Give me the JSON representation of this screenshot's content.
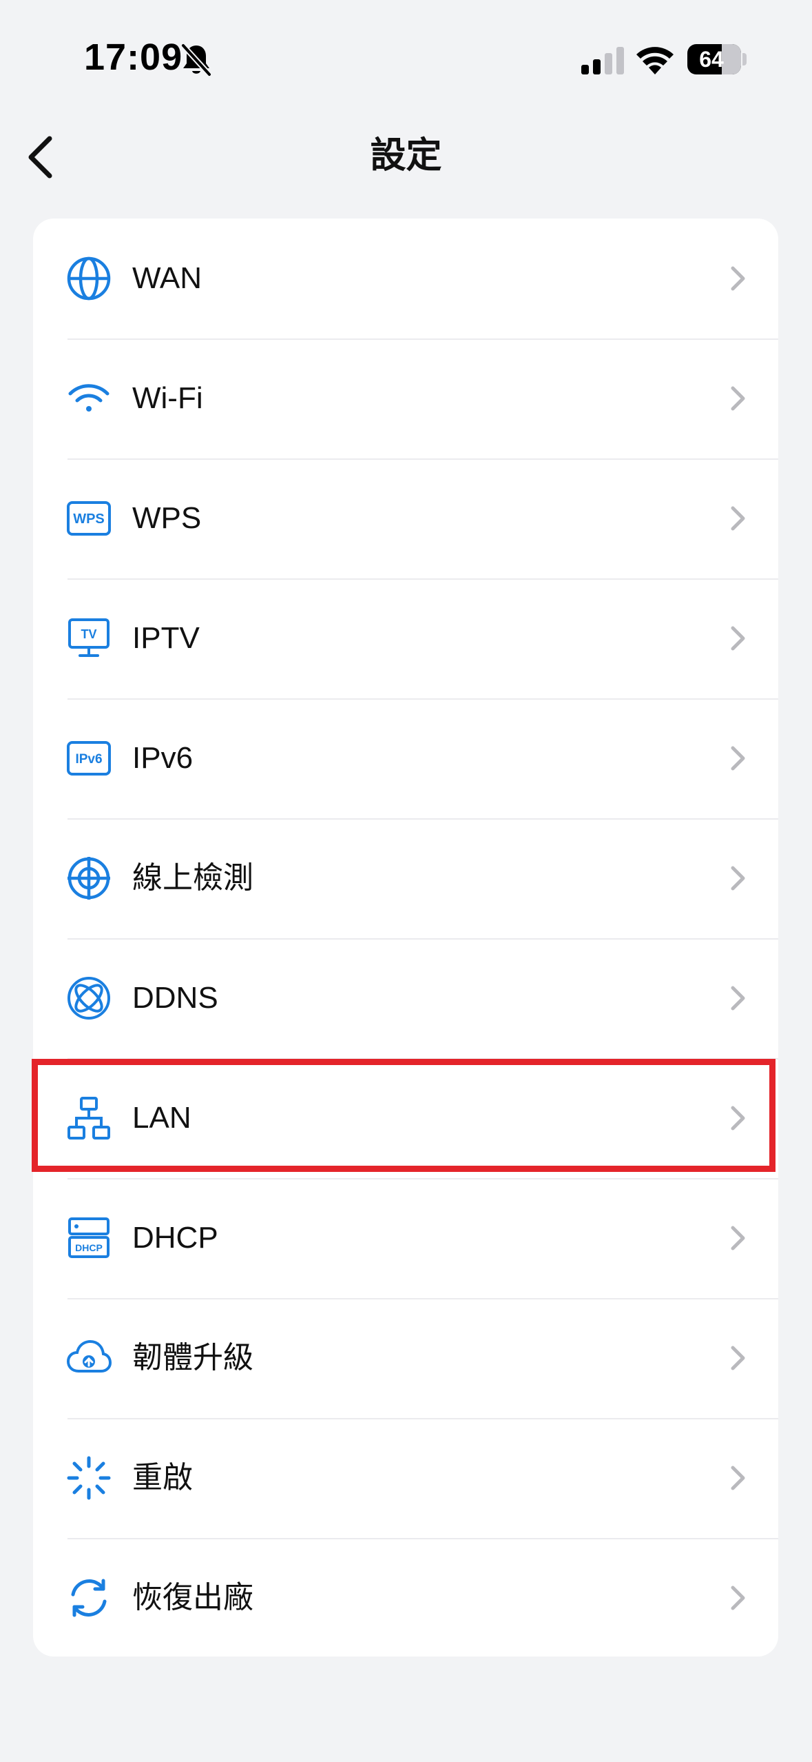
{
  "status_bar": {
    "time": "17:09",
    "battery_level": "64",
    "icons": [
      "mute-icon",
      "signal-icon",
      "wifi-icon",
      "battery-icon"
    ]
  },
  "nav": {
    "title": "設定",
    "back_icon": "chevron-left-icon"
  },
  "colors": {
    "accent": "#1a7fe0",
    "highlight": "#e4242a",
    "background": "#f2f3f5"
  },
  "settings": {
    "items": [
      {
        "label": "WAN",
        "icon": "globe-icon"
      },
      {
        "label": "Wi-Fi",
        "icon": "wifi-icon"
      },
      {
        "label": "WPS",
        "icon": "wps-icon"
      },
      {
        "label": "IPTV",
        "icon": "tv-icon"
      },
      {
        "label": "IPv6",
        "icon": "ipv6-icon"
      },
      {
        "label": "線上檢測",
        "icon": "crosshair-icon"
      },
      {
        "label": "DDNS",
        "icon": "orbit-globe-icon"
      },
      {
        "label": "LAN",
        "icon": "network-icon",
        "highlighted": true
      },
      {
        "label": "DHCP",
        "icon": "dhcp-icon"
      },
      {
        "label": "韌體升級",
        "icon": "cloud-upload-icon"
      },
      {
        "label": "重啟",
        "icon": "loading-spinner-icon"
      },
      {
        "label": "恢復出廠",
        "icon": "refresh-icon"
      }
    ]
  }
}
